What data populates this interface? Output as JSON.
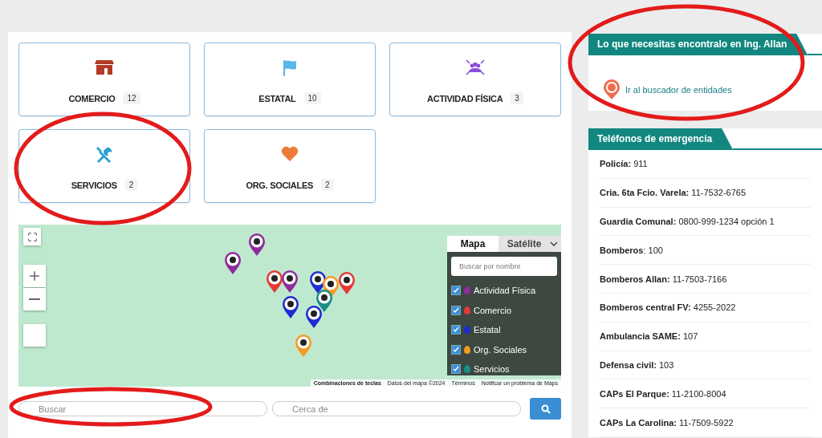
{
  "categories": [
    {
      "kind": "shop",
      "label": "COMERCIO",
      "count": "12"
    },
    {
      "kind": "flag",
      "label": "ESTATAL",
      "count": "10"
    },
    {
      "kind": "group",
      "label": "ACTIVIDAD FÍSICA",
      "count": "3"
    },
    {
      "kind": "tools",
      "label": "SERVICIOS",
      "count": "2"
    },
    {
      "kind": "heart",
      "label": "ORG. SOCIALES",
      "count": "2"
    }
  ],
  "map": {
    "map_types": [
      {
        "label": "Mapa",
        "selected": true
      },
      {
        "label": "Satélite",
        "selected": false
      }
    ],
    "filter": {
      "placeholder": "Buscar por nombre"
    },
    "layers": [
      {
        "label": "Actividad Física",
        "checked": true,
        "color": "#8e2c9c"
      },
      {
        "label": "Comercio",
        "checked": true,
        "color": "#e53935"
      },
      {
        "label": "Estatal",
        "checked": true,
        "color": "#1e2bd1"
      },
      {
        "label": "Org. Sociales",
        "checked": true,
        "color": "#f59a23"
      },
      {
        "label": "Servicios",
        "checked": true,
        "color": "#1a8f86"
      }
    ],
    "attribution": [
      "Combinaciones de teclas",
      "Datos del mapa ©2024",
      "Términos",
      "Notificar un problema de Maps"
    ]
  },
  "search": {
    "query_placeholder": "Buscar",
    "near_placeholder": "Cerca de"
  },
  "finder": {
    "title": "Lo que necesitas encontralo en Ing. Allan",
    "link": "Ir al buscador de entidades"
  },
  "emergency": {
    "title": "Teléfonos de emergencia",
    "rows": [
      {
        "name": "Policía:",
        "phone": "911"
      },
      {
        "name": "Cria. 6ta Fcio. Varela:",
        "phone": "11-7532-6765"
      },
      {
        "name": "Guardia Comunal:",
        "phone": "0800-999-1234 opción 1"
      },
      {
        "name": "Bomberos",
        "phone": ": 100"
      },
      {
        "name": "Bomberos Allan:",
        "phone": "11-7503-7166"
      },
      {
        "name": "Bomberos central FV:",
        "phone": "4255-2022"
      },
      {
        "name": "Ambulancia SAME:",
        "phone": "107"
      },
      {
        "name": "Defensa civil:",
        "phone": "103"
      },
      {
        "name": "CAPs El Parque:",
        "phone": "11-2100-8004"
      },
      {
        "name": "CAPs La Carolina:",
        "phone": "11-7509-5922"
      }
    ]
  }
}
